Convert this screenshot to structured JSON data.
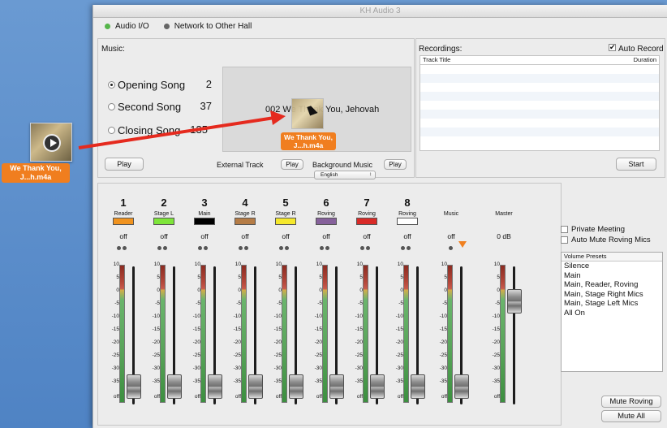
{
  "desktop": {
    "file_label": "We Thank You, J...h.m4a"
  },
  "window": {
    "title": "KH Audio 3"
  },
  "tabs": [
    {
      "label": "Audio I/O"
    },
    {
      "label": "Network to Other Hall"
    }
  ],
  "music": {
    "section_label": "Music:",
    "songs": [
      {
        "label": "Opening Song",
        "number": "2",
        "selected": true
      },
      {
        "label": "Second Song",
        "number": "37",
        "selected": false
      },
      {
        "label": "Closing Song",
        "number": "135",
        "selected": false
      }
    ],
    "now_playing": "002 We Thank You, Jehovah",
    "drag_label": "We Thank You, J...h.m4a",
    "play_button": "Play",
    "external_track_label": "External Track",
    "external_play_button": "Play",
    "background_music_label": "Background Music",
    "background_play_button": "Play",
    "language_select": "English"
  },
  "recordings": {
    "section_label": "Recordings:",
    "auto_record_label": "Auto Record",
    "auto_record_checked": true,
    "col_title": "Track Title",
    "col_duration": "Duration",
    "start_button": "Start"
  },
  "channels": [
    {
      "num": "1",
      "name": "Reader",
      "color": "#f0931f",
      "status": "off",
      "fader": 0.05
    },
    {
      "num": "2",
      "name": "Stage L",
      "color": "#7ee53a",
      "status": "off",
      "fader": 0.05
    },
    {
      "num": "3",
      "name": "Main",
      "color": "#000000",
      "status": "off",
      "fader": 0.05
    },
    {
      "num": "4",
      "name": "Stage R",
      "color": "#b57c46",
      "status": "off",
      "fader": 0.05
    },
    {
      "num": "5",
      "name": "Stage R",
      "color": "#f5e82c",
      "status": "off",
      "fader": 0.05
    },
    {
      "num": "6",
      "name": "Roving",
      "color": "#86619b",
      "status": "off",
      "fader": 0.05
    },
    {
      "num": "7",
      "name": "Roving",
      "color": "#d92a27",
      "status": "off",
      "fader": 0.05
    },
    {
      "num": "8",
      "name": "Roving",
      "color": "#ffffff",
      "status": "off",
      "fader": 0.05
    }
  ],
  "music_channel": {
    "name": "Music",
    "status": "off",
    "fader": 0.05
  },
  "master_channel": {
    "name": "Master",
    "status": "0 dB",
    "fader": 0.78
  },
  "meter_scale": [
    "10",
    "5",
    "0",
    "-5",
    "-10",
    "-15",
    "-20",
    "-25",
    "-30",
    "-35",
    "off"
  ],
  "options": {
    "private_meeting_label": "Private Meeting",
    "auto_mute_label": "Auto Mute Roving Mics"
  },
  "presets": {
    "header": "Volume Presets",
    "items": [
      "Silence",
      "Main",
      "Main, Reader, Roving",
      "Main, Stage Right Mics",
      "Main, Stage Left Mics",
      "All On"
    ]
  },
  "buttons": {
    "mute_roving": "Mute Roving",
    "mute_all": "Mute All"
  }
}
